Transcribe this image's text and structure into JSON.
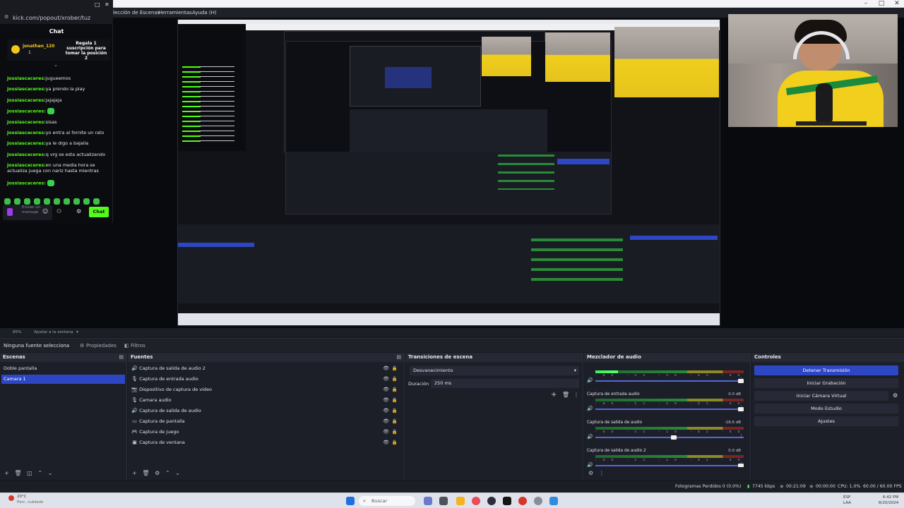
{
  "menubar": {
    "scene_collection": "lección de Escenas",
    "tools": "Herramientas",
    "help": "Ayuda (H)"
  },
  "chat": {
    "url": "kick.com/popout/xrober/tuz",
    "heading": "Chat",
    "pinned_user": "jonathan_120",
    "pinned_count": "1",
    "pinned_text": "Regala 1 suscripción para tomar la posición 2",
    "messages": [
      {
        "user": "Jossiascaceres:",
        "text": "jugueemos"
      },
      {
        "user": "Jossiascaceres:",
        "text": "ya prendo la play"
      },
      {
        "user": "Jossiascaceres:",
        "text": "jajajaja"
      },
      {
        "user": "Jossiascaceres:",
        "text": ""
      },
      {
        "user": "Jossiascaceres:",
        "text": "sisas"
      },
      {
        "user": "Jossiascaceres:",
        "text": "yo entra al fornite un rato"
      },
      {
        "user": "Jossiascaceres:",
        "text": "ya le digo a bajalla"
      },
      {
        "user": "Jossiascaceres:",
        "text": "q vrg se esta actualizando"
      },
      {
        "user": "Jossiascaceres:",
        "text": "en una media hora se actualiza juega con nariz hasta mientras"
      },
      {
        "user": "Jossiascaceres:",
        "text": ""
      }
    ],
    "input_placeholder": "Enviar un mensaje",
    "send_label": "Chat"
  },
  "preview_toolbar": {
    "zoom": "85%",
    "fit": "Ajustar a la ventana"
  },
  "source_toolbar": {
    "no_source": "Ninguna fuente selecciona",
    "properties": "Propiedades",
    "filters": "Filtros"
  },
  "scenes": {
    "title": "Escenas",
    "items": [
      {
        "label": "Doble pantalla",
        "selected": false
      },
      {
        "label": "Camara 1",
        "selected": true
      }
    ]
  },
  "sources": {
    "title": "Fuentes",
    "items": [
      {
        "icon": "audio-output-icon",
        "glyph": "🔊",
        "label": "Captura de salida de audio 2"
      },
      {
        "icon": "microphone-icon",
        "glyph": "🎙",
        "label": "Captura de entrada audio"
      },
      {
        "icon": "video-device-icon",
        "glyph": "📷",
        "label": "Dispositivo de captura de video"
      },
      {
        "icon": "microphone-icon",
        "glyph": "🎙",
        "label": "Camara audio"
      },
      {
        "icon": "audio-output-icon",
        "glyph": "🔊",
        "label": "Captura de salida de audio"
      },
      {
        "icon": "monitor-icon",
        "glyph": "▭",
        "label": "Captura de pantalla"
      },
      {
        "icon": "gamepad-icon",
        "glyph": "🎮",
        "label": "Captura de juego"
      },
      {
        "icon": "window-icon",
        "glyph": "▣",
        "label": "Captura de ventana"
      }
    ]
  },
  "transitions": {
    "title": "Transiciones de escena",
    "selected": "Desvanecimiento",
    "duration_label": "Duración",
    "duration_value": "250 ms"
  },
  "mixer": {
    "title": "Mezclador de audio",
    "tracks": [
      {
        "label": "",
        "db": "",
        "level": 0.15,
        "volume": 0.98
      },
      {
        "label": "Captura de entrada audio",
        "db": "0.0 dB",
        "level": 0.0,
        "volume": 0.98
      },
      {
        "label": "Captura de salida de audio",
        "db": "-18.6 dB",
        "level": 0.0,
        "volume": 0.53
      },
      {
        "label": "Captura de salida de audio 2",
        "db": "0.0 dB",
        "level": 0.0,
        "volume": 0.98
      }
    ],
    "ticks": "-60 -55 -50 -45 -40 -35 -30 -25 -20 -15 -10 -5 0"
  },
  "controls": {
    "title": "Controles",
    "stop_stream": "Detener Transmisión",
    "start_recording": "Iniciar Grabación",
    "start_virtualcam": "Iniciar Cámara Virtual",
    "studio_mode": "Modo Estudio",
    "settings": "Ajustes"
  },
  "status": {
    "dropped": "Fotogramas Perdidos 0 (0.0%)",
    "bitrate": "7745 kbps",
    "live_time": "00:21:09",
    "rec_time": "00:00:00",
    "cpu": "CPU: 1.0%",
    "fps": "60.00 / 60.00 FPS"
  },
  "taskbar": {
    "search": "Buscar",
    "weather_temp": "20°C",
    "weather_text": "Parc. nublado",
    "lang": "ESP",
    "lang2": "LAA",
    "time": "6:42 PM",
    "date": "8/20/2024"
  },
  "colors": {
    "accent": "#2d47c4",
    "kick_green": "#53fc18",
    "panel": "#1d1f28"
  }
}
